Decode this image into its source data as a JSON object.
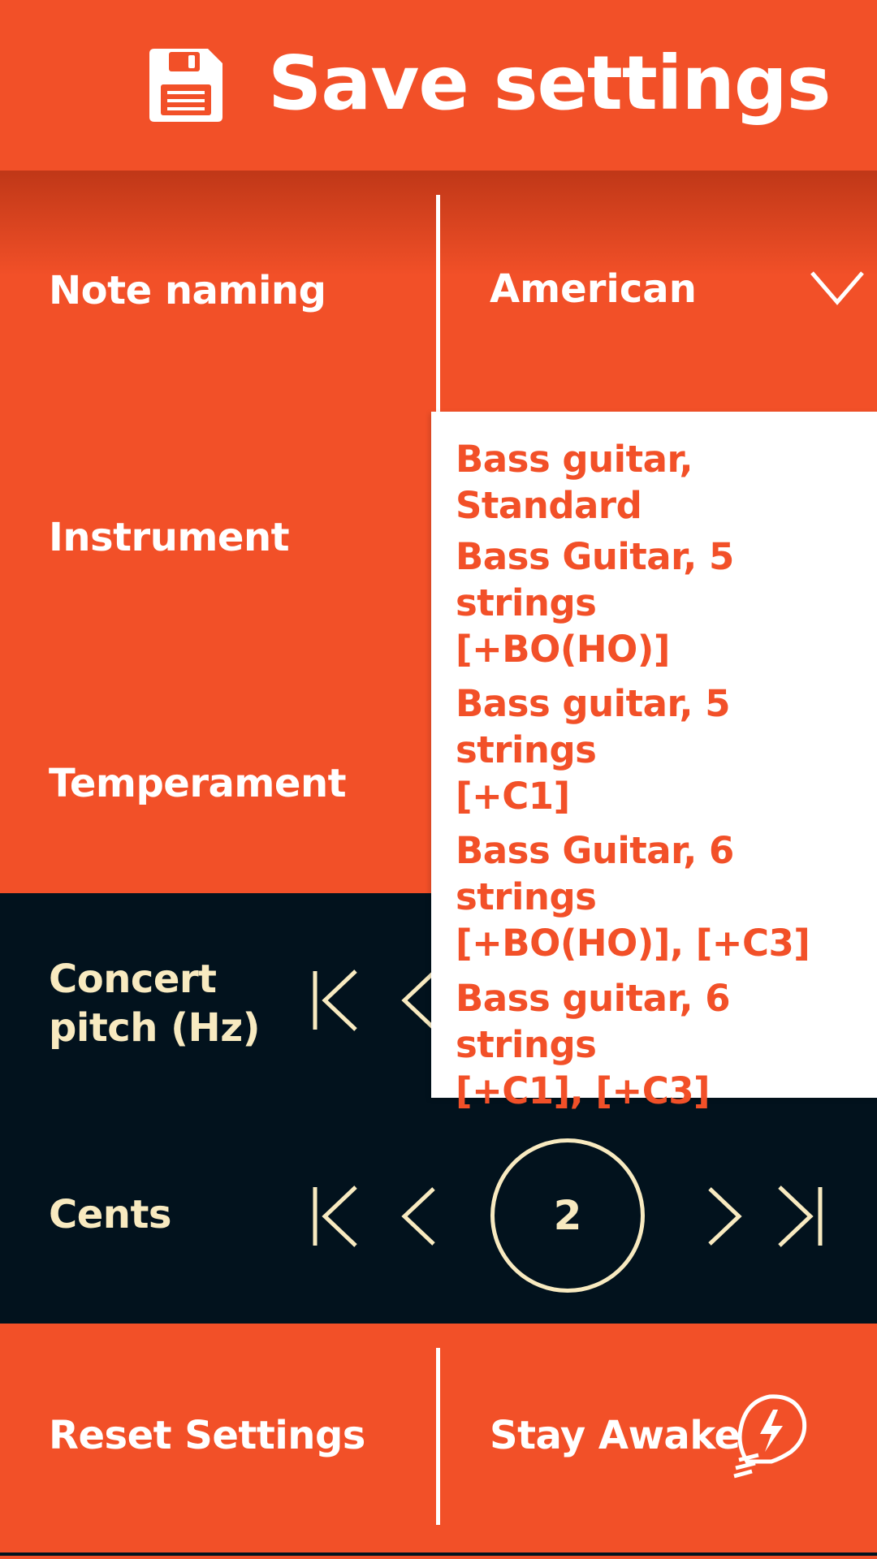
{
  "header": {
    "title": "Save settings",
    "icon": "floppy-disk-icon"
  },
  "settings": {
    "note_naming": {
      "label": "Note naming",
      "value": "American"
    },
    "instrument": {
      "label": "Instrument"
    },
    "temperament": {
      "label": "Temperament"
    },
    "concert_pitch": {
      "label_line1": "Concert",
      "label_line2": "pitch (Hz)"
    },
    "cents": {
      "label": "Cents",
      "value": "2"
    }
  },
  "dropdown": {
    "items": [
      {
        "line1": "Bass guitar, Standard",
        "line2": ""
      },
      {
        "line1": "Bass Guitar, 5 strings",
        "line2": "[+BO(HO)]"
      },
      {
        "line1": "Bass guitar, 5 strings",
        "line2": "[+C1]"
      },
      {
        "line1": "Bass Guitar, 6 strings",
        "line2": "[+BO(HO)], [+C3]"
      },
      {
        "line1": "Bass guitar, 6 strings",
        "line2": "[+C1], [+C3]"
      }
    ]
  },
  "footer": {
    "reset_label": "Reset Settings",
    "stay_awake_label": "Stay Awake"
  },
  "colors": {
    "accent": "#f25028",
    "dark": "#02121d",
    "cream": "#f8eac0",
    "white": "#ffffff"
  }
}
